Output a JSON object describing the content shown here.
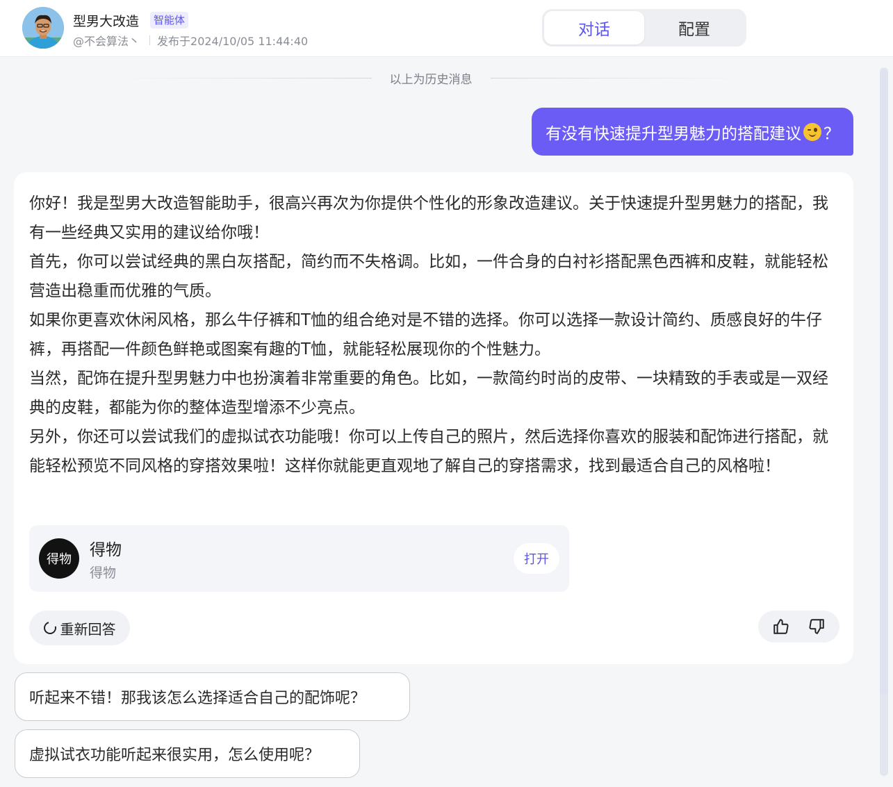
{
  "header": {
    "bot_name": "型男大改造",
    "bot_tag": "智能体",
    "author": "@不会算法丶",
    "published": "发布于2024/10/05 11:44:40",
    "tabs": [
      {
        "label": "对话",
        "active": true
      },
      {
        "label": "配置",
        "active": false
      }
    ]
  },
  "history_divider": "以上为历史消息",
  "user_message": {
    "text_before": "有没有快速提升型男魅力的搭配建议",
    "emoji": "winking-face-emoji",
    "text_after": "？"
  },
  "bot_message": {
    "paragraphs": [
      "你好！我是型男大改造智能助手，很高兴再次为你提供个性化的形象改造建议。关于快速提升型男魅力的搭配，我有一些经典又实用的建议给你哦！",
      "首先，你可以尝试经典的黑白灰搭配，简约而不失格调。比如，一件合身的白衬衫搭配黑色西裤和皮鞋，就能轻松营造出稳重而优雅的气质。",
      "如果你更喜欢休闲风格，那么牛仔裤和T恤的组合绝对是不错的选择。你可以选择一款设计简约、质感良好的牛仔裤，再搭配一件颜色鲜艳或图案有趣的T恤，就能轻松展现你的个性魅力。",
      "当然，配饰在提升型男魅力中也扮演着非常重要的角色。比如，一款简约时尚的皮带、一块精致的手表或是一双经典的皮鞋，都能为你的整体造型增添不少亮点。",
      "另外，你还可以尝试我们的虚拟试衣功能哦！你可以上传自己的照片，然后选择你喜欢的服装和配饰进行搭配，就能轻松预览不同风格的穿搭效果啦！这样你就能更直观地了解自己的穿搭需求，找到最适合自己的风格啦！"
    ],
    "app_card": {
      "logo_text": "得物",
      "name": "得物",
      "description": "得物",
      "open_label": "打开"
    },
    "regenerate_label": "重新回答"
  },
  "suggestions": [
    "听起来不错！那我该怎么选择适合自己的配饰呢？",
    "虚拟试衣功能听起来很实用，怎么使用呢？"
  ],
  "colors": {
    "accent": "#6c5cf6",
    "tab_active_text": "#5b55f0",
    "page_bg": "#f5f6f8"
  }
}
